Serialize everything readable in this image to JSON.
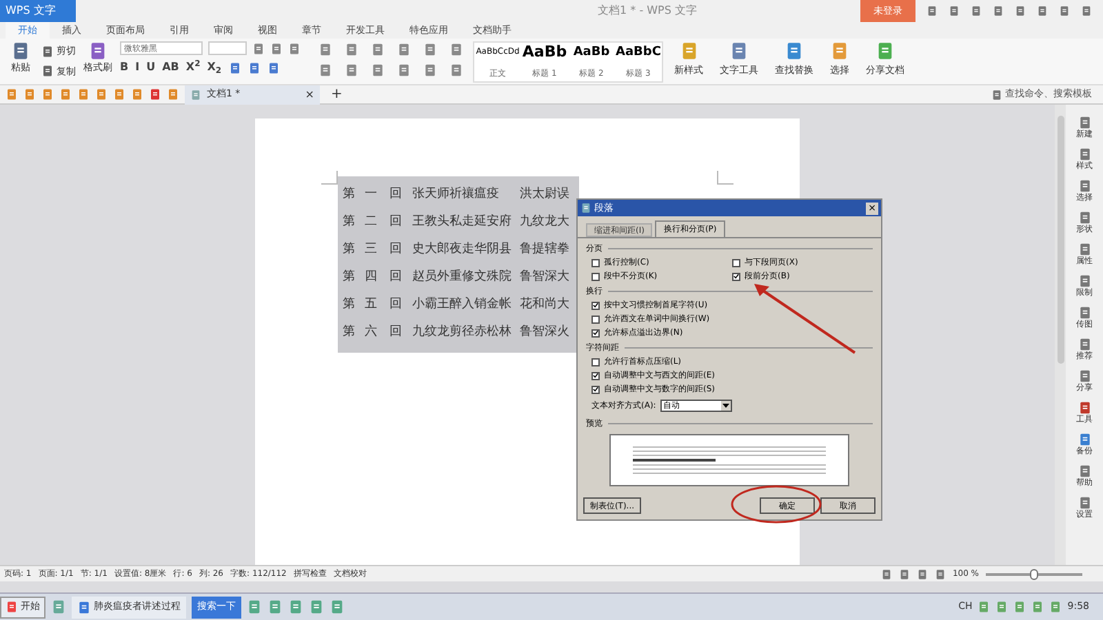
{
  "window": {
    "app_button": "WPS 文字",
    "title": "文档1 * - WPS 文字",
    "login": "未登录"
  },
  "ribbon_tabs": [
    {
      "label": "开始",
      "selected": true
    },
    {
      "label": "插入",
      "selected": false
    },
    {
      "label": "页面布局",
      "selected": false
    },
    {
      "label": "引用",
      "selected": false
    },
    {
      "label": "审阅",
      "selected": false
    },
    {
      "label": "视图",
      "selected": false
    },
    {
      "label": "章节",
      "selected": false
    },
    {
      "label": "开发工具",
      "selected": false
    },
    {
      "label": "特色应用",
      "selected": false
    },
    {
      "label": "文档助手",
      "selected": false
    }
  ],
  "clipboard": {
    "paste": "粘贴",
    "cut": "剪切",
    "copy": "复制",
    "format_painter": "格式刷"
  },
  "font": {
    "family": "微软雅黑",
    "format_buttons": [
      "B",
      "I",
      "U",
      "AB",
      "X$^{2}$",
      "X$_{2}$"
    ]
  },
  "styles": [
    {
      "sample": "AaBbCcDd",
      "label": "正文",
      "kind": "body"
    },
    {
      "sample": "AaBb",
      "label": "标题 1",
      "kind": "heading1"
    },
    {
      "sample": "AaBb",
      "label": "标题 2",
      "kind": "heading2"
    },
    {
      "sample": "AaBbC",
      "label": "标题 3",
      "kind": "heading3"
    }
  ],
  "tools": [
    "新样式",
    "文字工具",
    "查找替换",
    "选择",
    "分享文档"
  ],
  "doc_tab": {
    "label": "文档1 *",
    "close": "×",
    "add": "+"
  },
  "command_search": {
    "placeholder": "查找命令、搜索模板"
  },
  "document_rows": [
    {
      "cells": [
        "第",
        "一",
        "回",
        "张天师祈禳瘟疫",
        "洪太尉误"
      ]
    },
    {
      "cells": [
        "第",
        "二",
        "回",
        "王教头私走延安府",
        "九纹龙大"
      ]
    },
    {
      "cells": [
        "第",
        "三",
        "回",
        "史大郎夜走华阴县",
        "鲁提辖拳"
      ]
    },
    {
      "cells": [
        "第",
        "四",
        "回",
        "赵员外重修文殊院",
        "鲁智深大"
      ]
    },
    {
      "cells": [
        "第",
        "五",
        "回",
        "小霸王醉入销金帐",
        "花和尚大"
      ]
    },
    {
      "cells": [
        "第",
        "六",
        "回",
        "九纹龙剪径赤松林",
        "鲁智深火"
      ]
    }
  ],
  "dialog": {
    "title": "段落",
    "close": "×",
    "tabs": [
      {
        "label": "缩进和间距(I)",
        "selected": false
      },
      {
        "label": "换行和分页(P)",
        "selected": true
      }
    ],
    "sections": [
      {
        "title": "分页",
        "options": [
          {
            "label": "孤行控制(C)",
            "checked": false
          },
          {
            "label": "与下段同页(X)",
            "checked": false
          },
          {
            "label": "段中不分页(K)",
            "checked": false
          },
          {
            "label": "段前分页(B)",
            "checked": true
          }
        ]
      },
      {
        "title": "换行",
        "options": [
          {
            "label": "按中文习惯控制首尾字符(U)",
            "checked": true
          },
          {
            "label": "允许西文在单词中间换行(W)",
            "checked": false
          },
          {
            "label": "允许标点溢出边界(N)",
            "checked": true
          }
        ]
      },
      {
        "title": "字符间距",
        "options": [
          {
            "label": "允许行首标点压缩(L)",
            "checked": false
          },
          {
            "label": "自动调整中文与西文的间距(E)",
            "checked": true
          },
          {
            "label": "自动调整中文与数字的间距(S)",
            "checked": true
          }
        ]
      }
    ],
    "align": {
      "label": "文本对齐方式(A):",
      "value": "自动"
    },
    "preview_title": "预览",
    "buttons": [
      {
        "label": "制表位(T)...",
        "kind": "left"
      },
      {
        "label": "确定",
        "kind": "ok"
      },
      {
        "label": "取消",
        "kind": "cancel"
      }
    ]
  },
  "sidebar": [
    "新建",
    "样式",
    "选择",
    "形状",
    "属性",
    "限制",
    "传图",
    "推荐",
    "分享",
    "工具",
    "备份",
    "帮助",
    "设置"
  ],
  "status_bar": {
    "items": [
      "页码: 1",
      "页面: 1/1",
      "节: 1/1",
      "设置值: 8厘米",
      "行: 6",
      "列: 26",
      "字数: 112/112",
      "拼写检查",
      "文档校对"
    ],
    "zoom": "100 %",
    "zoom_slider": {
      "level": 0.5
    }
  },
  "taskbar": {
    "start": "开始",
    "windows": [
      {
        "label": "肺炎瘟疫者讲述过程",
        "selected": false
      },
      {
        "label": "搜索一下",
        "selected": true
      }
    ],
    "lang": "CH",
    "time": "9:58"
  }
}
